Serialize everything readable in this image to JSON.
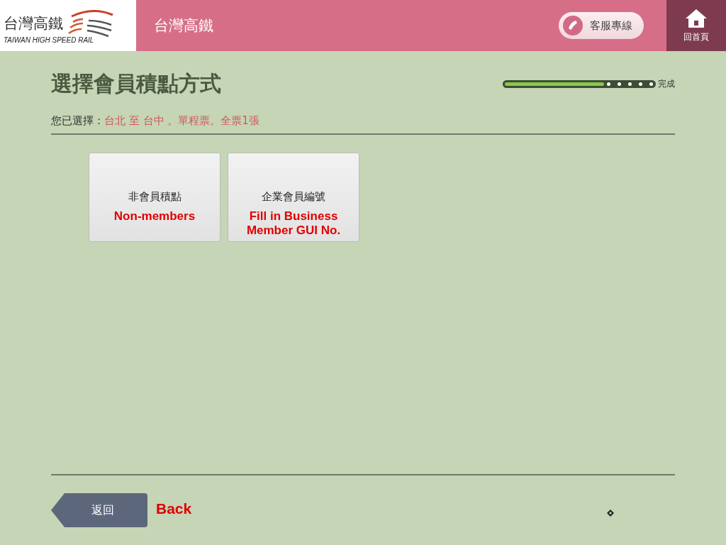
{
  "header": {
    "logo_name": "台灣高鐵",
    "logo_subtitle": "TAIWAN HIGH SPEED RAIL",
    "title": "台灣高鐵",
    "hotline_button": "客服專線",
    "home_button": "回首頁"
  },
  "page_title": "選擇會員積點方式",
  "progress": {
    "level": 0.65,
    "label": "完成"
  },
  "selection": {
    "label": "您已選擇：",
    "value": "台北 至 台中 。單程票。全票1張"
  },
  "options": [
    {
      "label": "非會員積點",
      "annotation": "Non-members"
    },
    {
      "label": "企業會員編號",
      "annotation": "Fill in Business Member GUI No."
    }
  ],
  "back_button": "返回",
  "back_annotation": "Back"
}
